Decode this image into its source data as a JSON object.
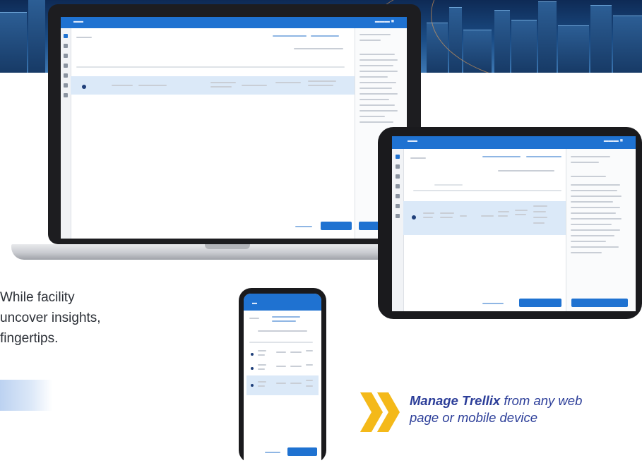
{
  "promo": {
    "lines": [
      "While facility",
      "uncover insights,",
      "fingertips."
    ]
  },
  "callout": {
    "emphasis": "Manage Trellix",
    "rest_line1": "from any web",
    "line2": "page or mobile device"
  },
  "colors": {
    "app_blue": "#1f72d1",
    "callout_text": "#2c3e99",
    "chevron": "#f4b919"
  }
}
